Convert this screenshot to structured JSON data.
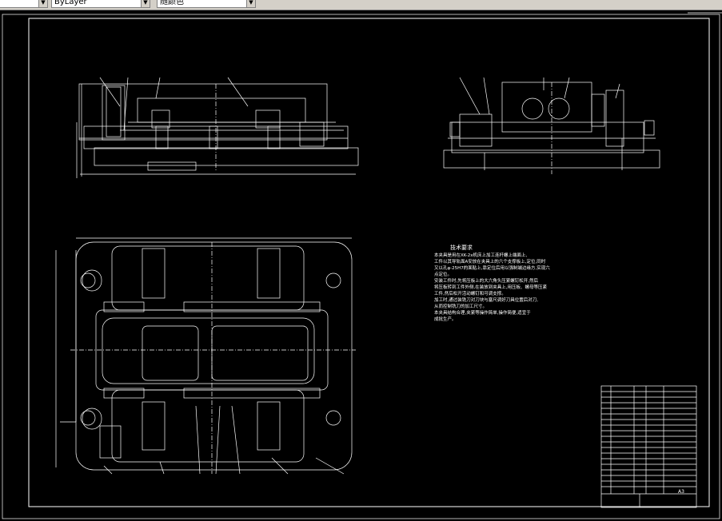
{
  "toolbar": {
    "dropdown1_value": "",
    "dropdown2_value": "ByLayer",
    "dropdown3_value": "随颜色"
  },
  "drawing": {
    "notes_title": "技术要求",
    "notes_body": "本夹具是用在XK-2x机床上加工连杆螺上端面上,\n工件以其导轨面A安放在夹具上的六个支撑板上,定位,同时\n又以孔φ-25H7的面贴上,靠定位后用以强制端边缘方,实现六\n点定位。\n安装工件时,先将压板上的大六角头压紧螺钉松开,然后\n将压板转到工件外侧,在装放到夹具上,用压板、螺母等压紧\n工件,然后松开活动螺钉和可调支撑。\n加工时,通过装铣刀对刀块与塞尺调好刀具位置后对刀,\n从而控制铣刀的加工尺寸。\n本夹具结构合理,夹紧等操作简单,操作简便,适宜于\n成批生产。",
    "title_block_text": "A3"
  },
  "colors": {
    "background": "#000000",
    "line_white": "#ffffff",
    "toolbar_gray": "#d4d0c8"
  }
}
